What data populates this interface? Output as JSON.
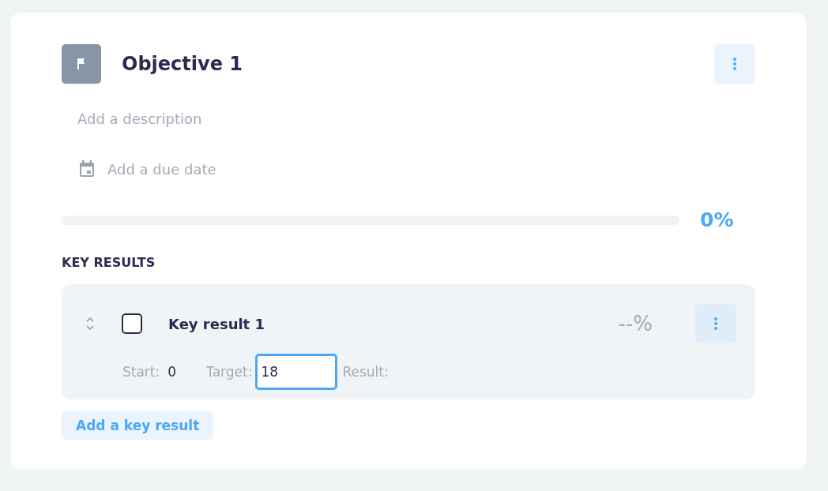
{
  "objective": {
    "title": "Objective 1",
    "description": {
      "placeholder": "Add a description"
    },
    "due_date": {
      "placeholder": "Add a due date"
    },
    "progress": {
      "level": 0,
      "percent": "0%"
    }
  },
  "key_results_heading": "KEY RESULTS",
  "key_results": [
    {
      "title": "Key result 1",
      "checked": false,
      "percent": "--%",
      "start_label": "Start:",
      "start_value": "0",
      "target_label": "Target:",
      "target": {
        "value": "18",
        "focused": true
      },
      "result_label": "Result:"
    }
  ],
  "add_button": "Add a key result"
}
